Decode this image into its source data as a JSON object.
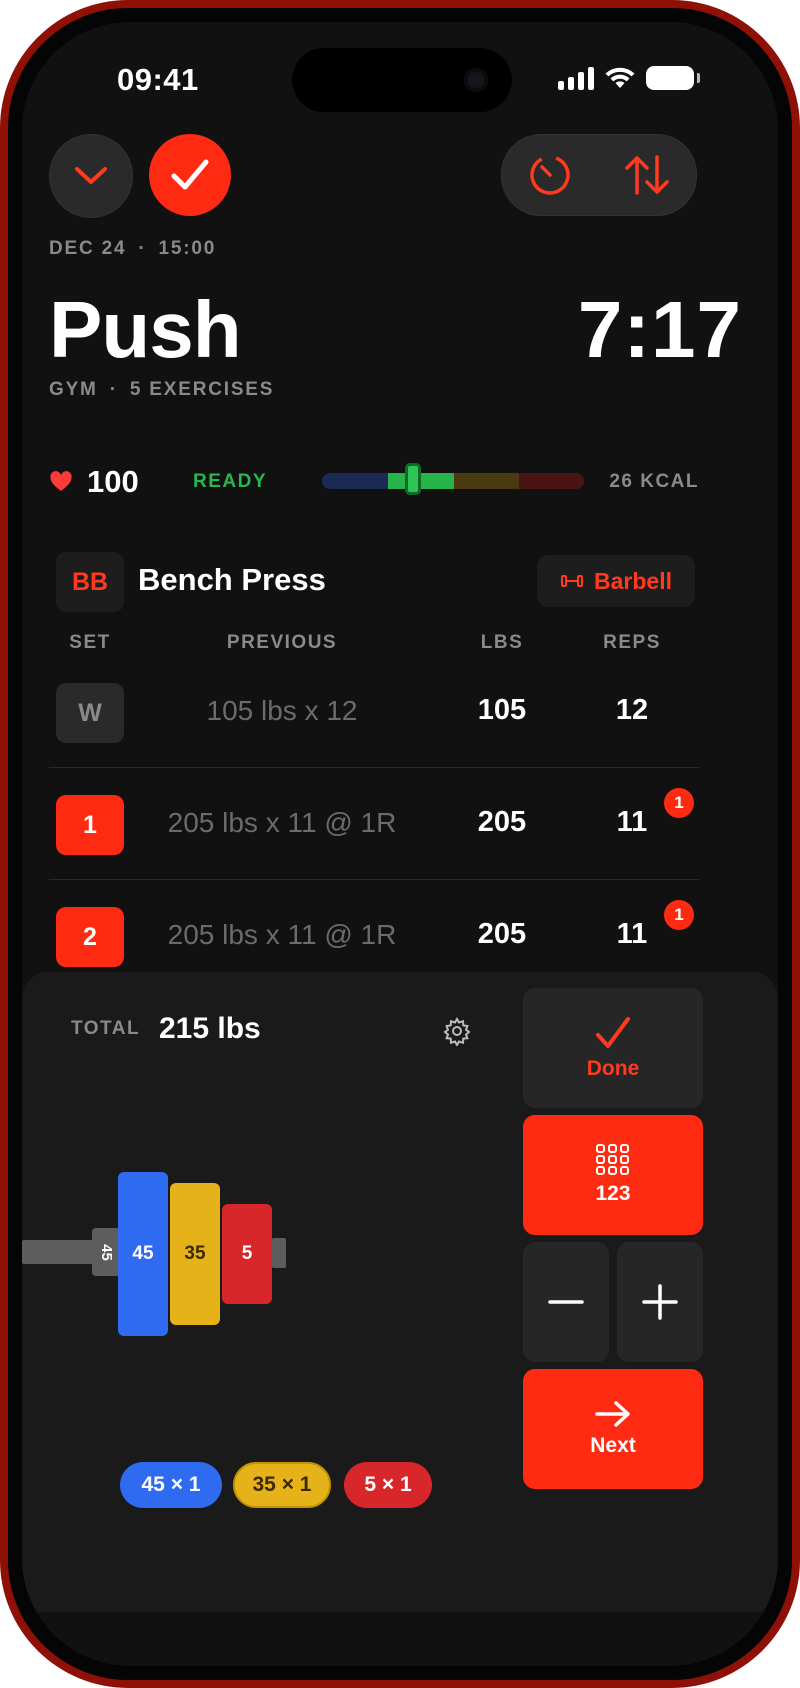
{
  "status_bar": {
    "time": "09:41"
  },
  "header": {
    "date": "DEC 24",
    "start_time": "15:00",
    "title": "Push",
    "timer": "7:17",
    "location": "GYM",
    "exercise_count": "5 EXERCISES"
  },
  "vitals": {
    "heart_rate": "100",
    "zone": "READY",
    "kcal": "26 KCAL",
    "zone_colors": [
      "#1b2a52",
      "#25b34a",
      "#4a3a10",
      "#4a1414"
    ]
  },
  "exercise": {
    "badge": "BB",
    "name": "Bench Press",
    "equipment": "Barbell"
  },
  "table": {
    "headers": {
      "set": "SET",
      "previous": "PREVIOUS",
      "lbs": "LBS",
      "reps": "REPS"
    },
    "rows": [
      {
        "set": "W",
        "previous": "105 lbs x 12",
        "lbs": "105",
        "reps": "12",
        "notif": ""
      },
      {
        "set": "1",
        "previous": "205 lbs x 11 @ 1R",
        "lbs": "205",
        "reps": "11",
        "notif": "1"
      },
      {
        "set": "2",
        "previous": "205 lbs x 11 @ 1R",
        "lbs": "205",
        "reps": "11",
        "notif": "1"
      }
    ]
  },
  "plate_calc": {
    "total_label": "TOTAL",
    "total_value": "215 lbs",
    "bar_label": "45",
    "plates": [
      {
        "label": "45",
        "color": "#2e6bf0"
      },
      {
        "label": "35",
        "color": "#e6b21a"
      },
      {
        "label": "5",
        "color": "#d8272b"
      }
    ],
    "chips": [
      "45 × 1",
      "35 × 1",
      "5 × 1"
    ]
  },
  "keypad": {
    "done": "Done",
    "numpad": "123",
    "next": "Next"
  },
  "colors": {
    "accent": "#ff2a12",
    "success": "#28b64e"
  }
}
